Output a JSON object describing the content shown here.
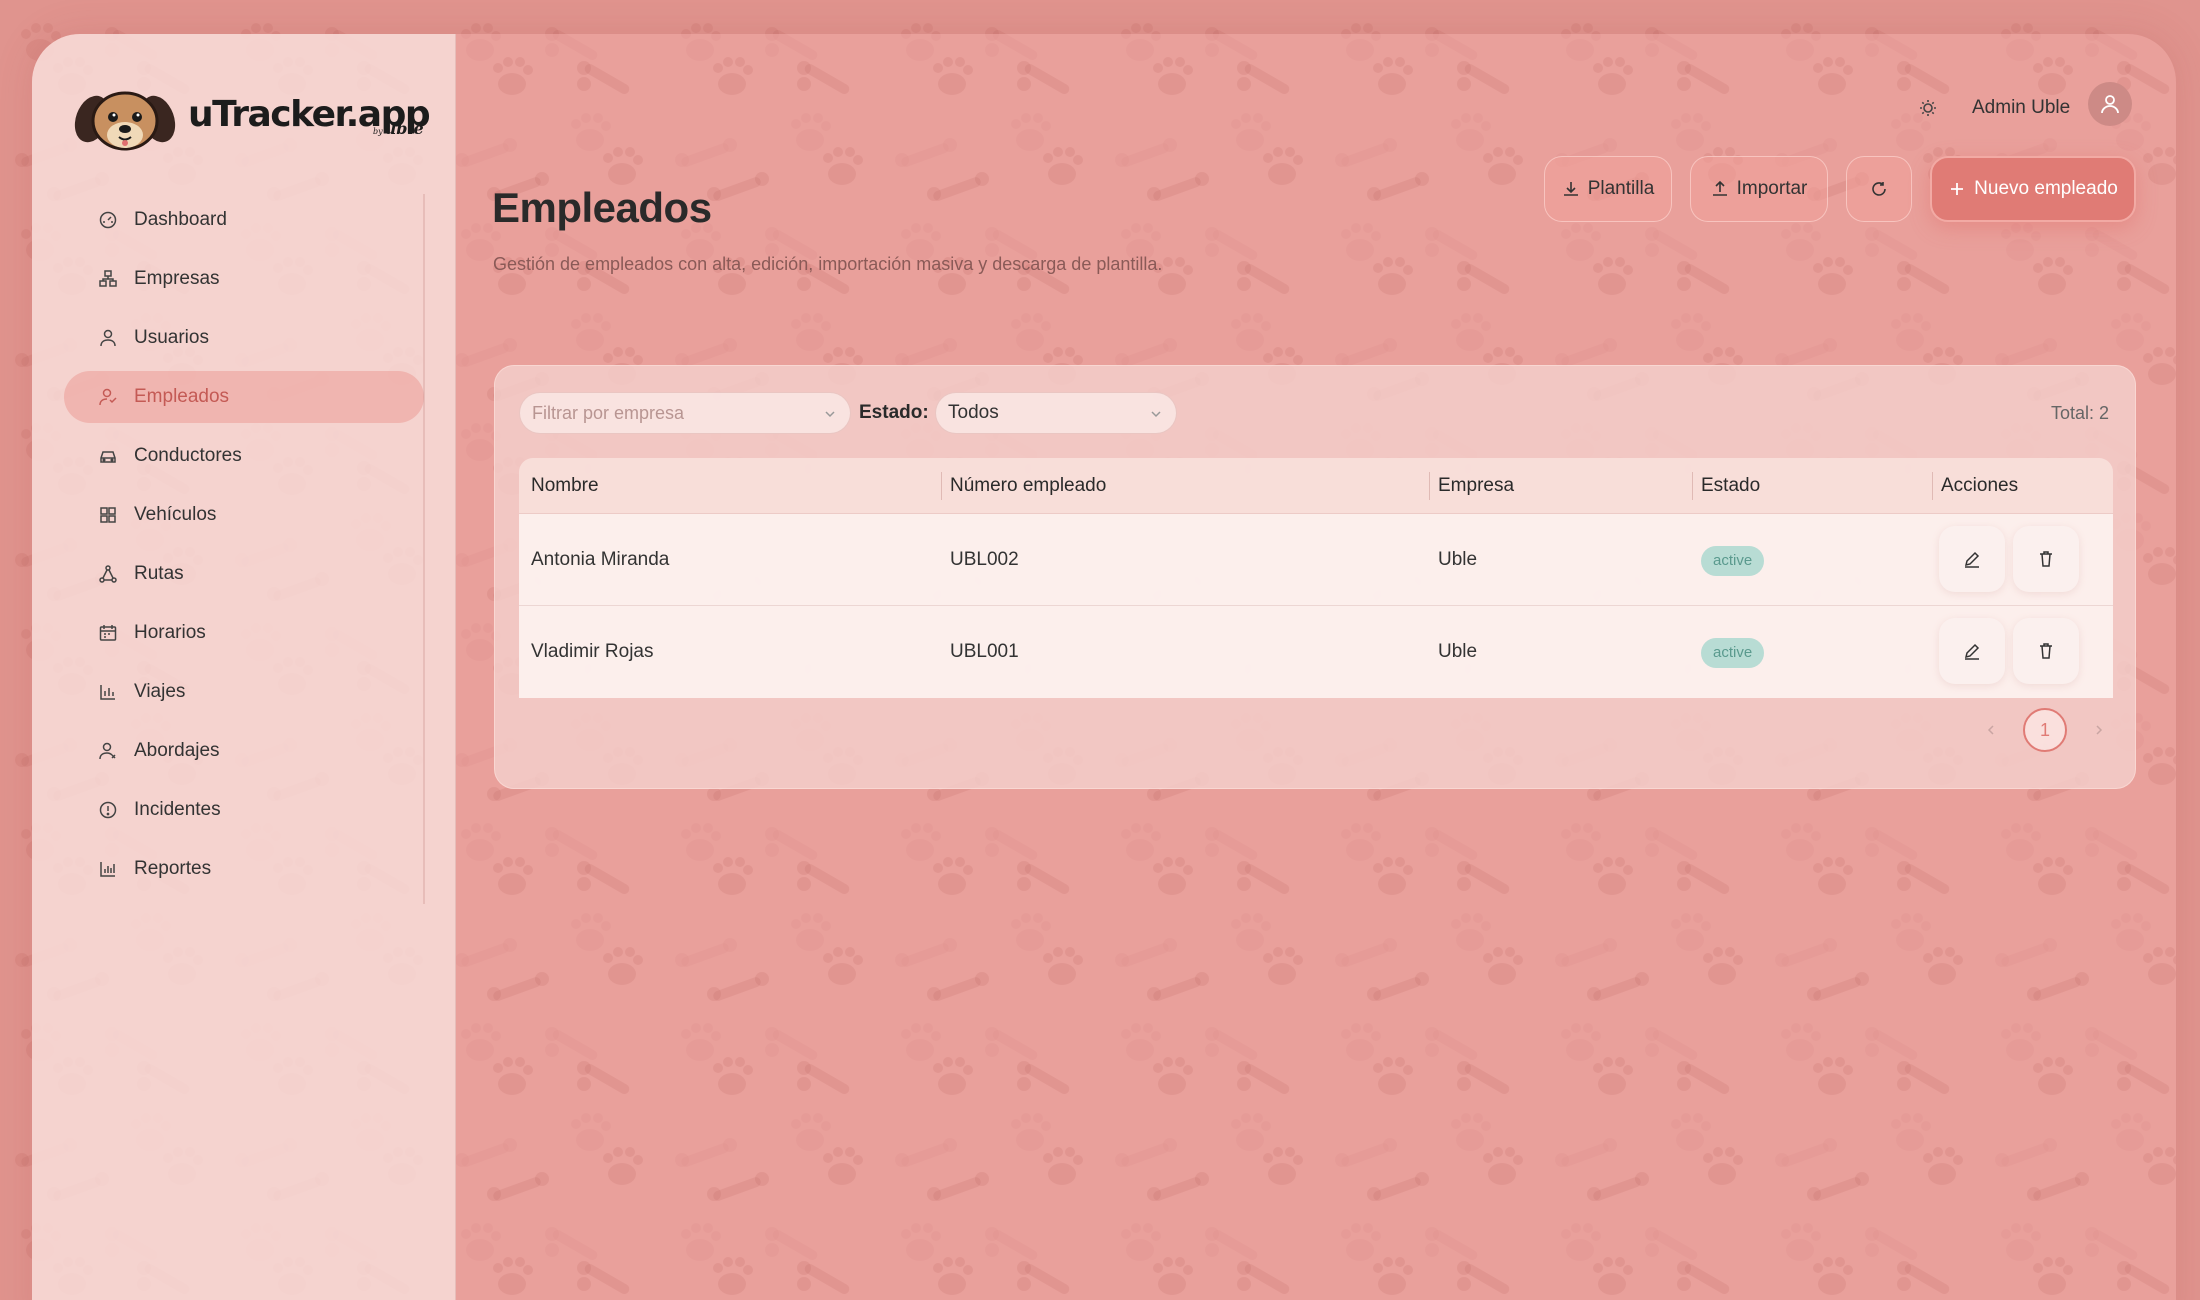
{
  "brand": {
    "name": "uTracker.app",
    "by_prefix": "by",
    "by_name": "uble"
  },
  "sidebar": {
    "items": [
      {
        "label": "Dashboard",
        "icon": "dashboard-gauge-icon"
      },
      {
        "label": "Empresas",
        "icon": "building-icon"
      },
      {
        "label": "Usuarios",
        "icon": "user-icon"
      },
      {
        "label": "Empleados",
        "icon": "employees-icon",
        "active": true
      },
      {
        "label": "Conductores",
        "icon": "car-icon"
      },
      {
        "label": "Vehículos",
        "icon": "grid-icon"
      },
      {
        "label": "Rutas",
        "icon": "route-icon"
      },
      {
        "label": "Horarios",
        "icon": "calendar-icon"
      },
      {
        "label": "Viajes",
        "icon": "bar-chart-icon"
      },
      {
        "label": "Abordajes",
        "icon": "boarding-icon"
      },
      {
        "label": "Incidentes",
        "icon": "alert-circle-icon"
      },
      {
        "label": "Reportes",
        "icon": "report-chart-icon"
      }
    ]
  },
  "header": {
    "user_name": "Admin Uble",
    "theme_icon": "sun-icon",
    "avatar_icon": "user-avatar-icon"
  },
  "page": {
    "title": "Empleados",
    "subtitle": "Gestión de empleados con alta, edición, importación masiva y descarga de plantilla."
  },
  "toolbar": {
    "plantilla_label": "Plantilla",
    "importar_label": "Importar",
    "nuevo_label": "Nuevo empleado"
  },
  "filters": {
    "empresa_placeholder": "Filtrar por empresa",
    "estado_label": "Estado:",
    "estado_value": "Todos",
    "total": "Total: 2"
  },
  "table": {
    "columns": [
      "Nombre",
      "Número empleado",
      "Empresa",
      "Estado",
      "Acciones"
    ],
    "rows": [
      {
        "nombre": "Antonia Miranda",
        "numero": "UBL002",
        "empresa": "Uble",
        "estado": "active"
      },
      {
        "nombre": "Vladimir Rojas",
        "numero": "UBL001",
        "empresa": "Uble",
        "estado": "active"
      }
    ]
  },
  "pagination": {
    "current": "1"
  },
  "colors": {
    "accent": "#e07b75",
    "badge_bg": "#b8dcd4",
    "badge_text": "#5a9a8e"
  }
}
